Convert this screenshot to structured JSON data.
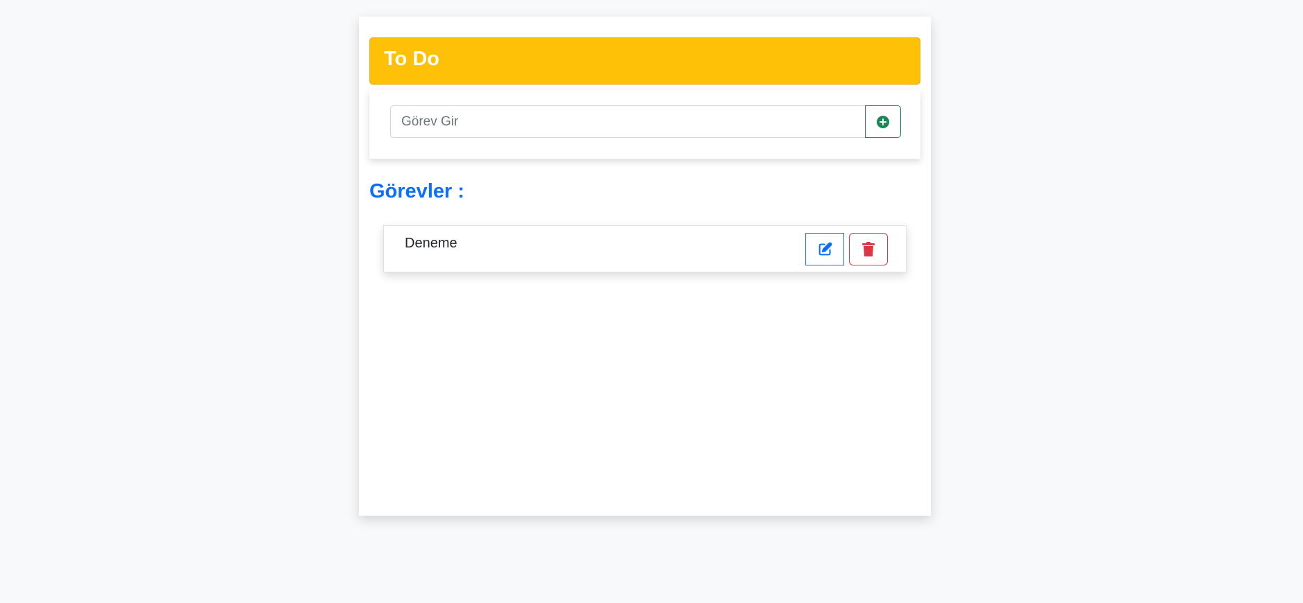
{
  "header": {
    "title": "To Do",
    "accent_color": "#ffc107"
  },
  "input": {
    "placeholder": "Görev Gir",
    "value": "",
    "add_button_icon": "plus-circle-icon",
    "add_button_color": "#198754"
  },
  "tasks_section": {
    "title": "Görevler :",
    "title_color": "#0d6efd"
  },
  "tasks": [
    {
      "text": "Deneme",
      "edit_icon": "edit-icon",
      "delete_icon": "trash-icon"
    }
  ],
  "colors": {
    "edit": "#0d6efd",
    "delete": "#dc3545"
  }
}
